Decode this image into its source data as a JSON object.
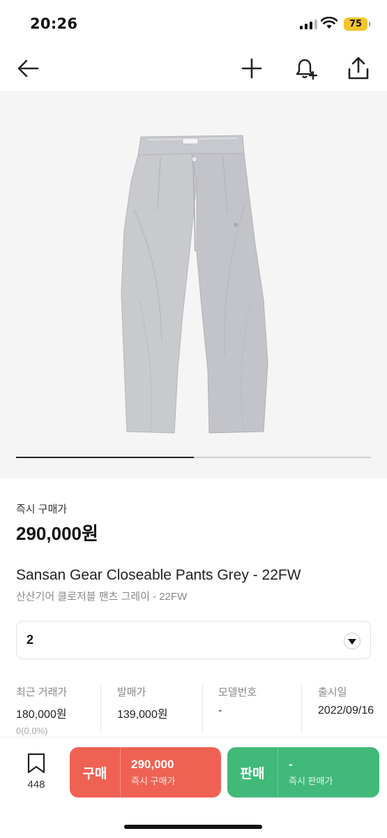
{
  "status_bar": {
    "time": "20:26",
    "battery": "75"
  },
  "product": {
    "price_label": "즉시 구매가",
    "price": "290,000원",
    "title_en": "Sansan Gear Closeable Pants Grey - 22FW",
    "title_ko": "산산기어 클로저블 팬츠 그레이 - 22FW",
    "image_position": 0.5
  },
  "size_select": {
    "value": "2"
  },
  "info": [
    {
      "label": "최근 거래가",
      "value": "180,000원",
      "sub": "0(0.0%)"
    },
    {
      "label": "발매가",
      "value": "139,000원"
    },
    {
      "label": "모델번호",
      "value": "-"
    },
    {
      "label": "출시일",
      "value": "2022/09/16"
    }
  ],
  "actions": {
    "wish_count": "448",
    "buy": {
      "label": "구매",
      "price": "290,000",
      "sub": "즉시 구매가"
    },
    "sell": {
      "label": "판매",
      "price": "-",
      "sub": "즉시 판매가"
    }
  },
  "icons": [
    "back-arrow-icon",
    "plus-icon",
    "bell-plus-icon",
    "share-icon",
    "bookmark-icon"
  ],
  "colors": {
    "buy": "#ef6253",
    "sell": "#41b979"
  }
}
